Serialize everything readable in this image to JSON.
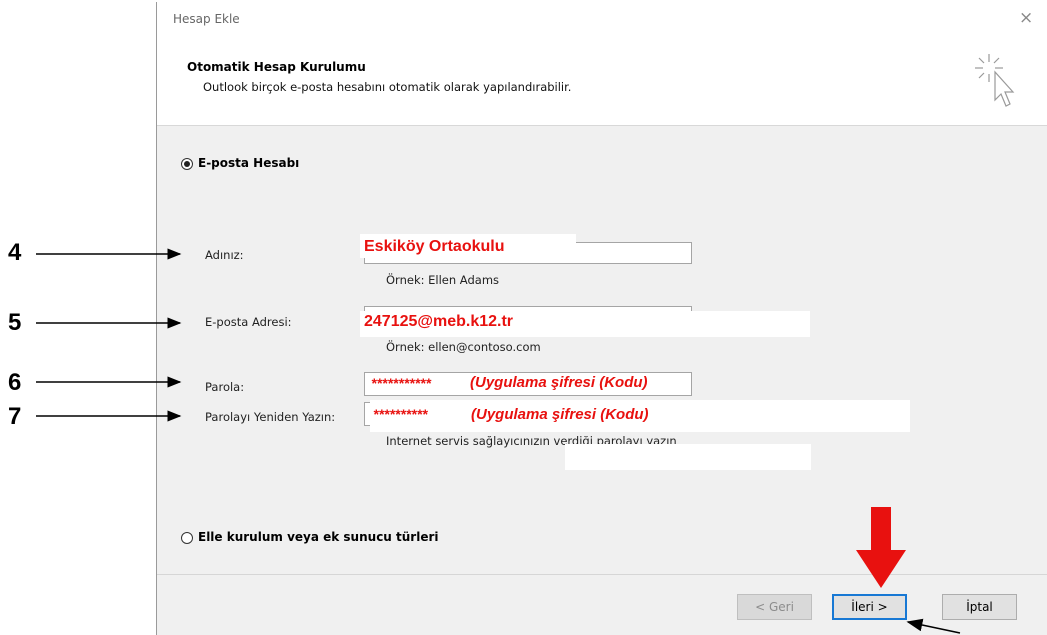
{
  "dialog": {
    "title": "Hesap Ekle",
    "close_glyph": "×",
    "header_title": "Otomatik Hesap Kurulumu",
    "header_subtitle": "Outlook birçok e-posta hesabını otomatik olarak yapılandırabilir."
  },
  "options": {
    "email_account": "E-posta Hesabı",
    "manual_setup": "Elle kurulum veya ek sunucu türleri"
  },
  "fields": {
    "name_label": "Adınız:",
    "name_value": "Eskiköy Ortaokulu",
    "name_hint": "Örnek: Ellen Adams",
    "email_label": "E-posta Adresi:",
    "email_value": "247125@meb.k12.tr",
    "email_hint": "Örnek: ellen@contoso.com",
    "password_label": "Parola:",
    "password_stars": "***********",
    "password_note": "(Uygulama şifresi (Kodu)",
    "retype_label": "Parolayı Yeniden Yazın:",
    "retype_stars": "**********",
    "retype_note": "(Uygulama şifresi (Kodu)",
    "password_hint": "Internet servis sağlayıcınızın verdiği parolayı yazın"
  },
  "buttons": {
    "back": "< Geri",
    "next": "İleri >",
    "cancel": "İptal"
  },
  "annotations": {
    "step_4": "4",
    "step_5": "5",
    "step_6": "6",
    "step_7": "7",
    "highlight_color": "#e8110f"
  }
}
